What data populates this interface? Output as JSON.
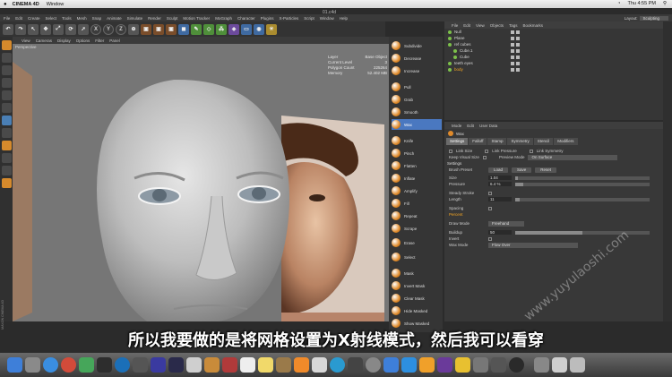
{
  "menubar": {
    "app": "CINEMA 4D",
    "items": [
      "Window"
    ],
    "clock": "Thu 4:55 PM"
  },
  "file_title": "01.c4d",
  "c4d_menu": [
    "File",
    "Edit",
    "Create",
    "Select",
    "Tools",
    "Mesh",
    "Snap",
    "Animate",
    "Simulate",
    "Render",
    "Sculpt",
    "Motion Tracker",
    "MoGraph",
    "Character",
    "Plugins",
    "X-Particles",
    "Script",
    "Window",
    "Help"
  ],
  "layout": {
    "label": "Layout:",
    "value": "Sculpting"
  },
  "toolbar": {
    "x": "X",
    "y": "Y",
    "z": "Z"
  },
  "viewport": {
    "menu": [
      "View",
      "Cameras",
      "Display",
      "Options",
      "Filter",
      "Panel"
    ],
    "label": "Perspective",
    "hud": [
      {
        "k": "Layer",
        "v": "Base Object"
      },
      {
        "k": "Current Level",
        "v": "3"
      },
      {
        "k": "Polygon Count",
        "v": "225264"
      },
      {
        "k": "Memory",
        "v": "52.402 MB"
      }
    ]
  },
  "brushes": [
    {
      "label": "Subdivide",
      "active": false
    },
    {
      "label": "Decrease",
      "active": false
    },
    {
      "label": "Increase",
      "active": false
    },
    {
      "label": "Pull",
      "active": false
    },
    {
      "label": "Grab",
      "active": false
    },
    {
      "label": "Smooth",
      "active": false
    },
    {
      "label": "Wax",
      "active": true
    },
    {
      "label": "Knife",
      "active": false
    },
    {
      "label": "Pinch",
      "active": false
    },
    {
      "label": "Flatten",
      "active": false
    },
    {
      "label": "Inflate",
      "active": false
    },
    {
      "label": "Amplify",
      "active": false
    },
    {
      "label": "Fill",
      "active": false
    },
    {
      "label": "Repeat",
      "active": false
    },
    {
      "label": "Scrape",
      "active": false
    },
    {
      "label": "Erase",
      "active": false
    },
    {
      "label": "Select",
      "active": false
    },
    {
      "label": "Mask",
      "active": false
    },
    {
      "label": "Invert Mask",
      "active": false
    },
    {
      "label": "Clear Mask",
      "active": false
    },
    {
      "label": "Hide Masked",
      "active": false
    },
    {
      "label": "Show Masked",
      "active": false
    }
  ],
  "object_manager": {
    "menu": [
      "File",
      "Edit",
      "View",
      "Objects",
      "Tags",
      "Bookmarks"
    ],
    "objects": [
      {
        "name": "Null"
      },
      {
        "name": "Plane"
      },
      {
        "name": "ref cubes"
      },
      {
        "name": "Cube.1"
      },
      {
        "name": "Cube"
      },
      {
        "name": "teeth eyes"
      },
      {
        "name": "body"
      }
    ]
  },
  "attribute_manager": {
    "menu": [
      "Mode",
      "Edit",
      "User Data"
    ],
    "object_name": "Wax",
    "tabs": [
      "Settings",
      "Falloff",
      "Stamp",
      "Symmetry",
      "Stencil",
      "Modifiers"
    ],
    "link_size": "Link Size",
    "link_pressure": "Link Pressure",
    "link_symmetry": "Link Symmetry",
    "keep_visual_size": "Keep Visual Size",
    "preview_mode_label": "Preview Mode",
    "preview_mode_value": "On Surface",
    "settings_section": "Settings",
    "brush_preset": "Brush Preset",
    "load": "Load",
    "save": "Save",
    "reset": "Reset",
    "size_label": "Size",
    "size_value": "1.04",
    "size_fill": 0.02,
    "pressure_label": "Pressure",
    "pressure_value": "6.4 %",
    "pressure_fill": 0.06,
    "steady_stroke": "Steady Stroke",
    "length_label": "Length",
    "length_value": "11",
    "length_fill": 0.03,
    "spacing": "Spacing",
    "percent": "Percent",
    "draw_mode_label": "Draw Mode",
    "draw_mode_value": "Freehand",
    "buildup_label": "Buildup",
    "buildup_value": "50",
    "buildup_fill": 0.5,
    "invert": "Invert",
    "wax_mode_label": "Wax Mode",
    "wax_mode_value": "Flow Over"
  },
  "subtitle": "所以我要做的是将网格设置为X射线模式，然后我可以看穿",
  "watermark": "www.yuyulaoshi.com",
  "maxon": "MAXON CINEMA 4D"
}
